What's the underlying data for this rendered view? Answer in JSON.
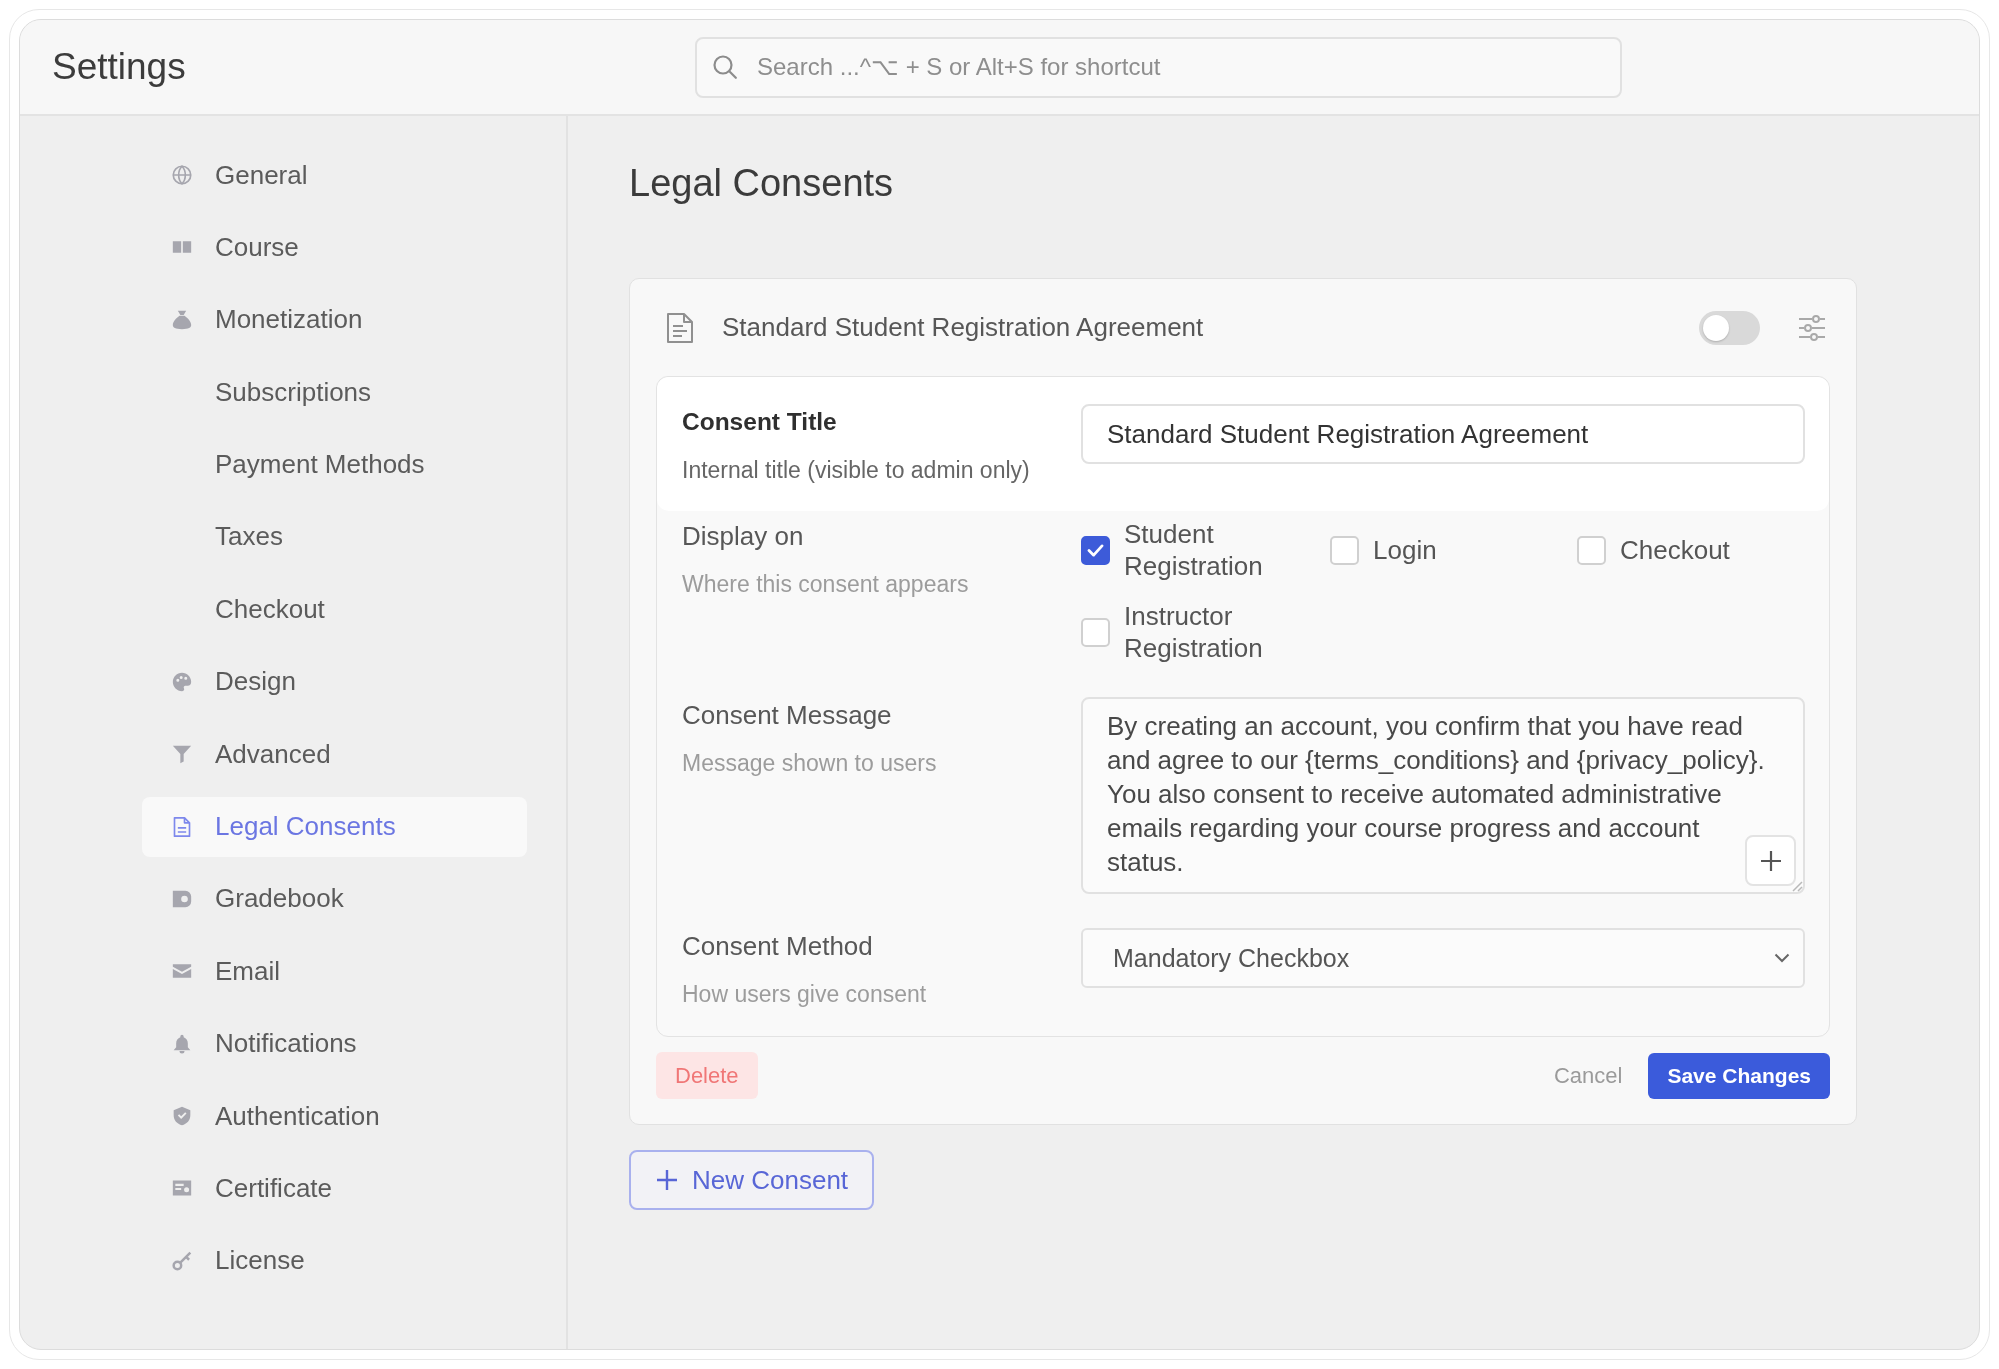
{
  "header": {
    "title": "Settings",
    "search": {
      "placeholder": "Search ...^⌥ + S or Alt+S for shortcut"
    }
  },
  "sidebar": {
    "items": [
      {
        "label": "General",
        "selected": false
      },
      {
        "label": "Course",
        "selected": false
      },
      {
        "label": "Monetization",
        "selected": false,
        "children": [
          {
            "label": "Subscriptions",
            "selected": false
          },
          {
            "label": "Payment Methods",
            "selected": false
          },
          {
            "label": "Taxes",
            "selected": false
          },
          {
            "label": "Checkout",
            "selected": false
          }
        ]
      },
      {
        "label": "Design",
        "selected": false
      },
      {
        "label": "Advanced",
        "selected": false
      },
      {
        "label": "Legal Consents",
        "selected": true
      },
      {
        "label": "Gradebook",
        "selected": false
      },
      {
        "label": "Email",
        "selected": false
      },
      {
        "label": "Notifications",
        "selected": false
      },
      {
        "label": "Authentication",
        "selected": false
      },
      {
        "label": "Certificate",
        "selected": false
      },
      {
        "label": "License",
        "selected": false
      }
    ]
  },
  "page": {
    "title": "Legal Consents"
  },
  "consents": [
    {
      "title": "Standard Student Registration Agreement",
      "enabled": false,
      "fields": [
        {
          "kind": "text",
          "label": "Consent Title",
          "description": "Internal title (visible to admin only)",
          "highlighted": true,
          "value": "Standard Student Registration Agreement"
        },
        {
          "kind": "checkboxes",
          "label": "Display on",
          "description": "Where this consent appears",
          "highlighted": false,
          "options": [
            {
              "label": "Student Registration",
              "checked": true
            },
            {
              "label": "Login",
              "checked": false
            },
            {
              "label": "Checkout",
              "checked": false
            },
            {
              "label": "Instructor Registration",
              "checked": false
            }
          ]
        },
        {
          "kind": "textarea",
          "label": "Consent Message",
          "description": "Message shown to users",
          "highlighted": false,
          "value": "By creating an account, you confirm that you have read and agree to our {terms_conditions} and {privacy_policy}. You also consent to receive automated administrative emails regarding your course progress and account status."
        },
        {
          "kind": "select",
          "label": "Consent Method",
          "description": "How users give consent",
          "highlighted": false,
          "value": "Mandatory Checkbox"
        }
      ],
      "buttons": [
        {
          "kind": "danger",
          "label": "Delete"
        },
        {
          "kind": "plain",
          "label": "Cancel"
        },
        {
          "kind": "primary",
          "label": "Save Changes"
        }
      ]
    }
  ],
  "new_consent_button": {
    "label": "New Consent"
  }
}
